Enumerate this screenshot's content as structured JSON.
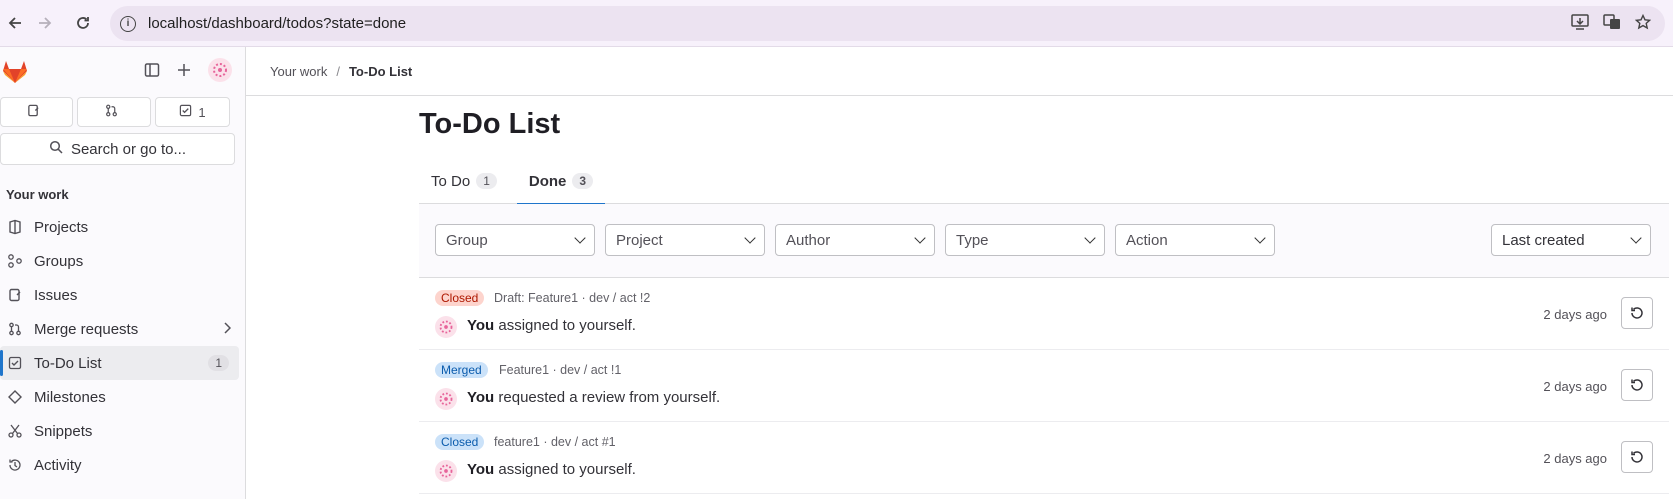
{
  "browser": {
    "url": "localhost/dashboard/todos?state=done",
    "back_icon": "arrow-left-icon",
    "forward_icon": "arrow-right-icon",
    "reload_icon": "reload-icon"
  },
  "sidebar": {
    "counts": [
      {
        "icon": "issues-icon",
        "value": ""
      },
      {
        "icon": "merge-request-icon",
        "value": ""
      },
      {
        "icon": "todo-icon",
        "value": "1"
      }
    ],
    "search_label": "Search or go to...",
    "section_title": "Your work",
    "items": [
      {
        "label": "Projects",
        "icon": "project-icon"
      },
      {
        "label": "Groups",
        "icon": "group-icon"
      },
      {
        "label": "Issues",
        "icon": "issues-icon"
      },
      {
        "label": "Merge requests",
        "icon": "merge-request-icon"
      },
      {
        "label": "To-Do List",
        "icon": "todo-icon",
        "badge": "1"
      },
      {
        "label": "Milestones",
        "icon": "milestone-icon"
      },
      {
        "label": "Snippets",
        "icon": "snippet-icon"
      },
      {
        "label": "Activity",
        "icon": "history-icon"
      }
    ]
  },
  "breadcrumb": {
    "parent": "Your work",
    "separator": "/",
    "current": "To-Do List"
  },
  "page": {
    "title": "To-Do List"
  },
  "tabs": [
    {
      "label": "To Do",
      "count": "1"
    },
    {
      "label": "Done",
      "count": "3"
    }
  ],
  "filters": {
    "group": "Group",
    "project": "Project",
    "author": "Author",
    "type": "Type",
    "action": "Action",
    "sort": "Last created"
  },
  "todos": [
    {
      "status": "Closed",
      "ref": "Draft: Feature1 · dev / act !2",
      "actor": "You",
      "action": " assigned to yourself.",
      "time": "2 days ago"
    },
    {
      "status": "Merged",
      "ref": "Feature1 · dev / act !1",
      "actor": "You",
      "action": " requested a review from yourself.",
      "time": "2 days ago"
    },
    {
      "status": "Closed",
      "ref": "feature1 · dev / act #1",
      "actor": "You",
      "action": " assigned to yourself.",
      "time": "2 days ago"
    }
  ],
  "colors": {
    "accent": "#1f75cb",
    "closed_red": "#fdd4cd",
    "merged_blue": "#cbe2f9"
  }
}
